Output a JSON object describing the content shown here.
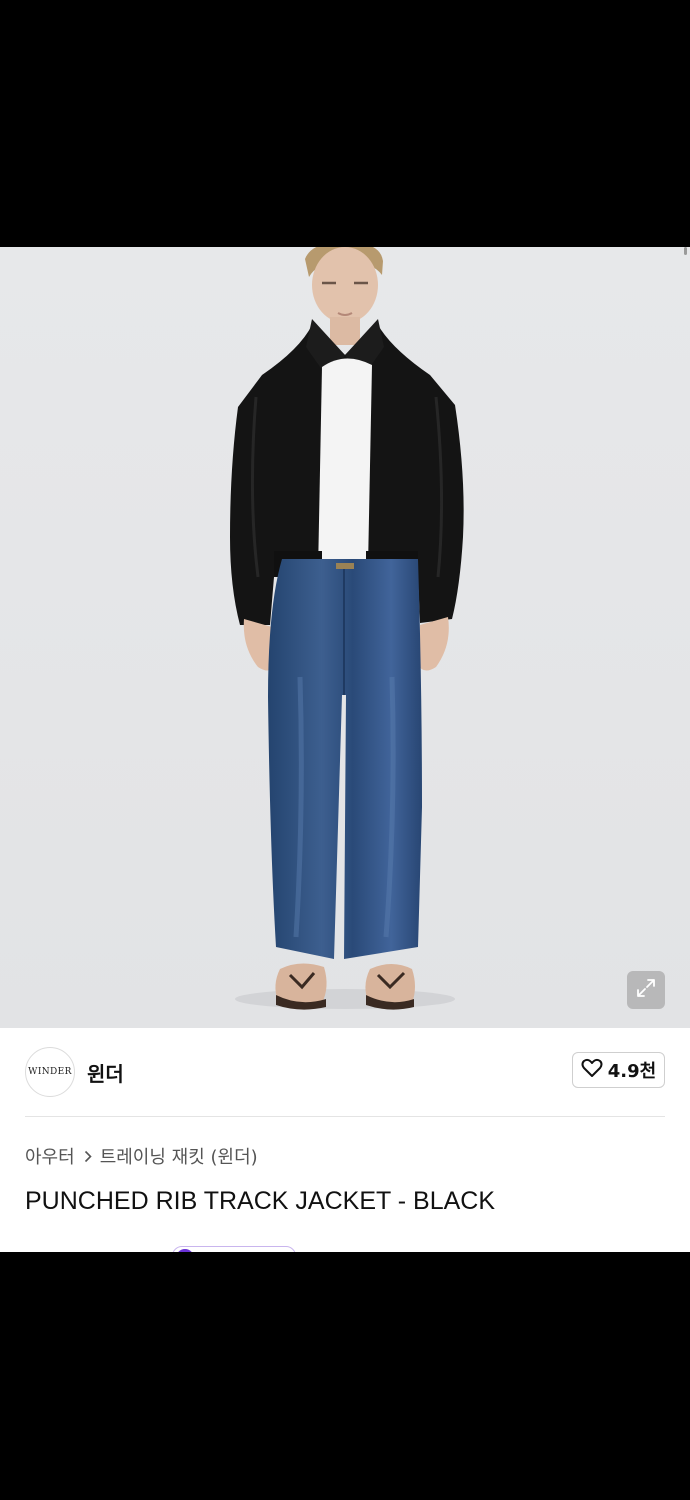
{
  "brand": {
    "logo_text": "WINDER",
    "name": "윈더"
  },
  "like": {
    "count": "4.9천"
  },
  "breadcrumb": {
    "items": [
      "아우터",
      "트레이닝 재킷 (윈더)"
    ]
  },
  "product": {
    "title": "PUNCHED RIB TRACK JACKET - BLACK"
  },
  "colors": {
    "hero_background": "#e6e7e9",
    "jacket": "#141414",
    "denim": "#2f4e7c",
    "badge_accent": "#6b32d6"
  },
  "icons": {
    "expand": "expand-icon",
    "like": "heart-outline-icon",
    "breadcrumb_separator": "chevron-right-icon"
  }
}
